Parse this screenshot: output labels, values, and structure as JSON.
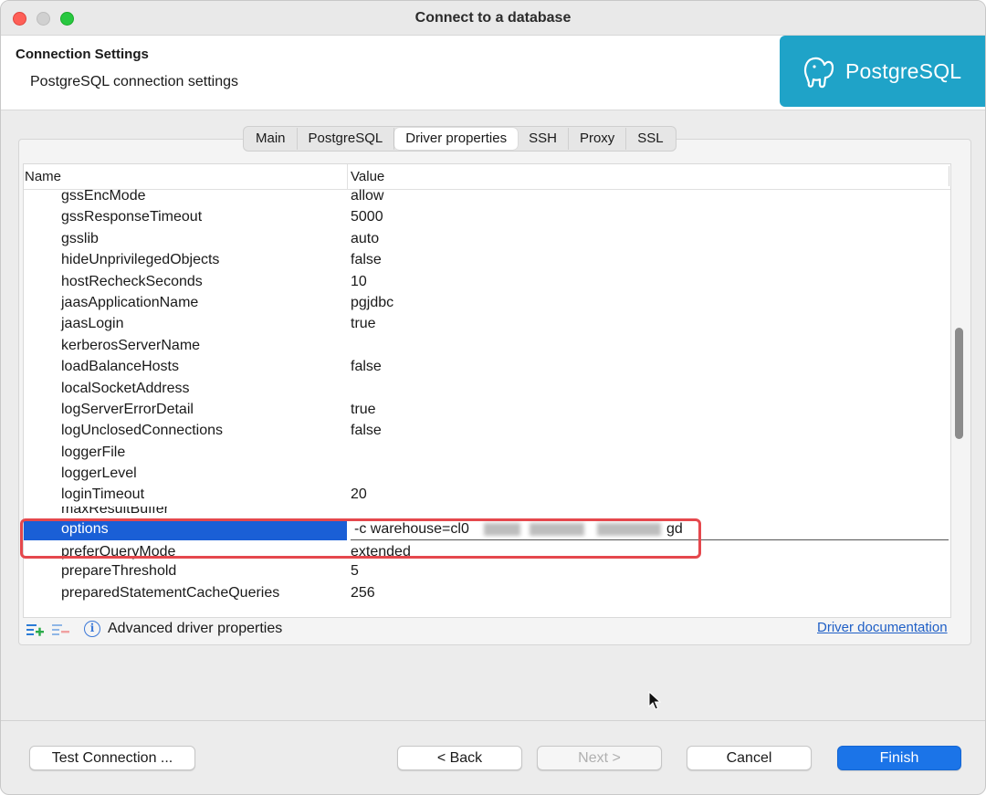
{
  "window": {
    "title": "Connect to a database"
  },
  "header": {
    "title": "Connection Settings",
    "subtitle": "PostgreSQL connection settings",
    "logo_text": "PostgreSQL",
    "logo_color": "#1fa3c8"
  },
  "tabs": [
    {
      "label": "Main",
      "active": false
    },
    {
      "label": "PostgreSQL",
      "active": false
    },
    {
      "label": "Driver properties",
      "active": true
    },
    {
      "label": "SSH",
      "active": false
    },
    {
      "label": "Proxy",
      "active": false
    },
    {
      "label": "SSL",
      "active": false
    }
  ],
  "table": {
    "columns": {
      "name": "Name",
      "value": "Value"
    },
    "rows": [
      {
        "name": "gssEncMode",
        "value": "allow"
      },
      {
        "name": "gssResponseTimeout",
        "value": "5000"
      },
      {
        "name": "gsslib",
        "value": "auto"
      },
      {
        "name": "hideUnprivilegedObjects",
        "value": "false"
      },
      {
        "name": "hostRecheckSeconds",
        "value": "10"
      },
      {
        "name": "jaasApplicationName",
        "value": "pgjdbc"
      },
      {
        "name": "jaasLogin",
        "value": "true"
      },
      {
        "name": "kerberosServerName",
        "value": ""
      },
      {
        "name": "loadBalanceHosts",
        "value": "false"
      },
      {
        "name": "localSocketAddress",
        "value": ""
      },
      {
        "name": "logServerErrorDetail",
        "value": "true"
      },
      {
        "name": "logUnclosedConnections",
        "value": "false"
      },
      {
        "name": "loggerFile",
        "value": ""
      },
      {
        "name": "loggerLevel",
        "value": ""
      },
      {
        "name": "loginTimeout",
        "value": "20"
      },
      {
        "name": "maxResultBuffer",
        "value": ""
      }
    ],
    "selected_row": {
      "name": "options",
      "value_visible_prefix": "-c warehouse=cl0",
      "value_visible_suffix": "gd"
    },
    "rows_after": [
      {
        "name": "preferQueryMode",
        "value": "extended"
      },
      {
        "name": "prepareThreshold",
        "value": "5"
      },
      {
        "name": "preparedStatementCacheQueries",
        "value": "256"
      }
    ],
    "selection_color": "#1a5fd6",
    "highlight_color": "#e5484d"
  },
  "bottom_bar": {
    "advanced_label": "Advanced driver properties",
    "doc_link": "Driver documentation",
    "add_icon": "add-property-icon",
    "remove_icon": "remove-property-icon",
    "info_icon": "info-icon"
  },
  "footer": {
    "test_connection": "Test Connection ...",
    "back": "< Back",
    "next": "Next >",
    "cancel": "Cancel",
    "finish": "Finish",
    "accent": "#1b74e8"
  }
}
